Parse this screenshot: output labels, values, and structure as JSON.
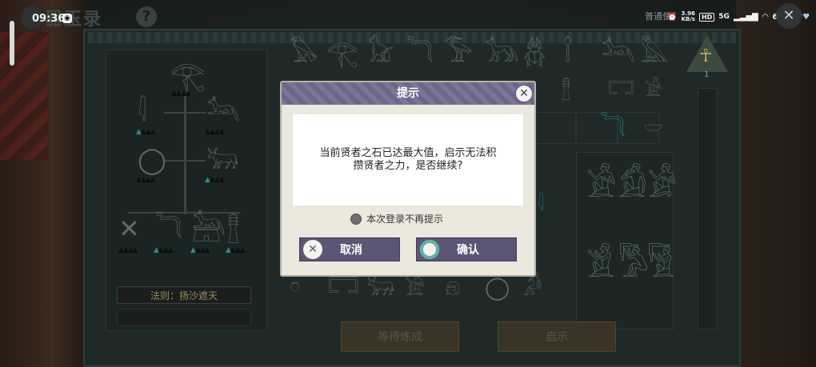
{
  "status_bar": {
    "time": "09:36",
    "net_speed": "3.96\nKB/s",
    "hd": "HD",
    "signal": "5G",
    "battery": "67%"
  },
  "header": {
    "title": "器玉录",
    "mode_label": "普通使"
  },
  "board": {
    "rule_label": "法则：扬沙遮天",
    "pyramid_level": "1",
    "craft_button": "等待炼成",
    "reveal_button": "启示"
  },
  "dialog": {
    "title": "提示",
    "message": "当前贤者之石已达最大值，启示无法积攒贤者之力，是否继续?",
    "dont_show_again": "本次登录不再提示",
    "cancel_label": "取消",
    "confirm_label": "确认"
  },
  "colors": {
    "dialog_header": "#6c678a",
    "button_bg": "#5b5676",
    "accent_teal": "#2d8d86"
  }
}
